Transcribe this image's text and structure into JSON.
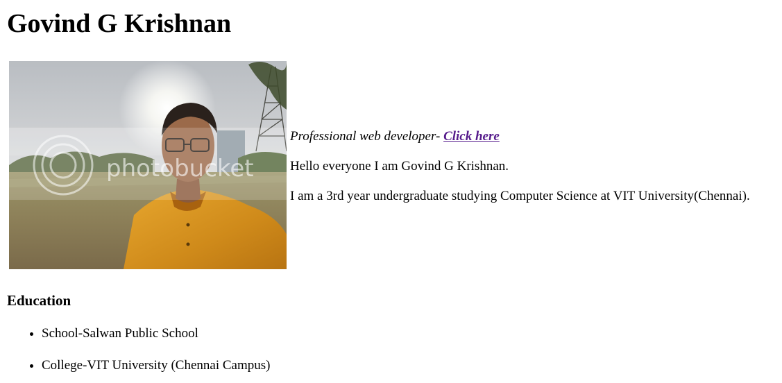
{
  "page": {
    "title": "Govind G Krishnan"
  },
  "photo": {
    "alt": "Govind G Krishnan",
    "watermark": "photobucket"
  },
  "intro": {
    "tagline_text": "Professional web developer- ",
    "tagline_link": "Click here",
    "greeting": "Hello everyone I am Govind G Krishnan.",
    "bio": "I am a 3rd year undergraduate studying Computer Science at VIT University(Chennai)."
  },
  "education": {
    "heading": "Education",
    "items": [
      "School-Salwan Public School",
      "College-VIT University (Chennai Campus)"
    ]
  },
  "colors": {
    "visited_link": "#551a8b",
    "text": "#000000",
    "background": "#ffffff"
  }
}
